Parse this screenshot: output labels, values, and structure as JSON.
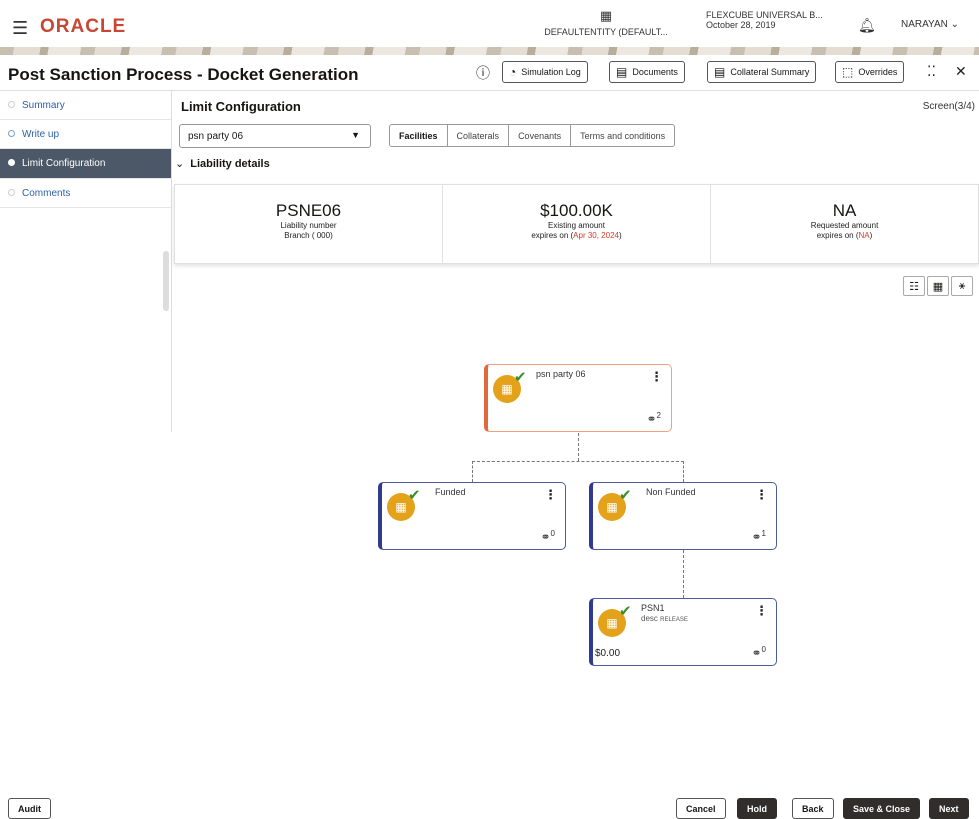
{
  "header": {
    "brand": "ORACLE",
    "entity": "DEFAULTENTITY (DEFAULT...",
    "branch_name": "FLEXCUBE UNIVERSAL B...",
    "branch_date": "October 28, 2019",
    "user": "NARAYAN"
  },
  "titlebar": {
    "title": "Post Sanction Process - Docket Generation",
    "simulation_log": "Simulation Log",
    "documents": "Documents",
    "collateral_summary": "Collateral Summary",
    "overrides": "Overrides"
  },
  "sidebar": {
    "items": [
      {
        "label": "Summary"
      },
      {
        "label": "Write up"
      },
      {
        "label": "Limit Configuration"
      },
      {
        "label": "Comments"
      }
    ]
  },
  "main": {
    "heading": "Limit Configuration",
    "screen": "Screen(3/4)",
    "party_select": "psn party 06",
    "tabs": [
      "Facilities",
      "Collaterals",
      "Covenants",
      "Terms and conditions"
    ],
    "liability_heading": "Liability details",
    "cards": [
      {
        "value": "PSNE06",
        "label": "Liability number",
        "sub": "Branch ( 000)"
      },
      {
        "value": "$100.00K",
        "label": "Existing amount",
        "sub_prefix": "expires on (",
        "sub_red": "Apr 30, 2024",
        "sub_suffix": ")"
      },
      {
        "value": "NA",
        "label": "Requested amount",
        "sub_prefix": "expires on (",
        "sub_red": "NA",
        "sub_suffix": ")"
      }
    ]
  },
  "tree": {
    "root": {
      "name": "psn party 06",
      "links": "2"
    },
    "funded": {
      "name": "Funded",
      "links": "0"
    },
    "nonfunded": {
      "name": "Non Funded",
      "links": "1"
    },
    "leaf": {
      "name": "PSN1",
      "desc": "desc",
      "status": "RELEASE",
      "amount": "$0.00",
      "links": "0"
    }
  },
  "footer": {
    "audit": "Audit",
    "cancel": "Cancel",
    "hold": "Hold",
    "back": "Back",
    "save_close": "Save & Close",
    "next": "Next"
  }
}
